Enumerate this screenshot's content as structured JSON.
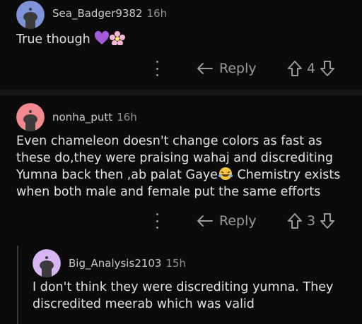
{
  "comments": [
    {
      "username": "Sea_Badger9382",
      "time": "16h",
      "text": "True though",
      "avatar_color": "#7f93d8",
      "emojis": [
        "purple-heart",
        "cherry-blossom"
      ],
      "reply_label": "Reply",
      "score": "4"
    },
    {
      "username": "nonha_putt",
      "time": "16h",
      "text_parts": [
        "Even chameleon doesn't change colors as fast as these do,they were praising wahaj and discrediting Yumna back then ,ab palat Gaye",
        " Chemistry exists when both male and female put the same efforts"
      ],
      "avatar_color": "#f08a8f",
      "emojis": [
        "laughing-tears"
      ],
      "reply_label": "Reply",
      "score": "3"
    },
    {
      "username": "Big_Analysis2103",
      "time": "15h",
      "text": "I don't think they were discrediting yumna. They discredited meerab which was valid",
      "avatar_color": "#d8b6f2"
    }
  ],
  "colors": {
    "background": "#0b0b0b",
    "text": "#e2e2e2",
    "muted": "#9a9a9a",
    "divider": "#151515"
  }
}
